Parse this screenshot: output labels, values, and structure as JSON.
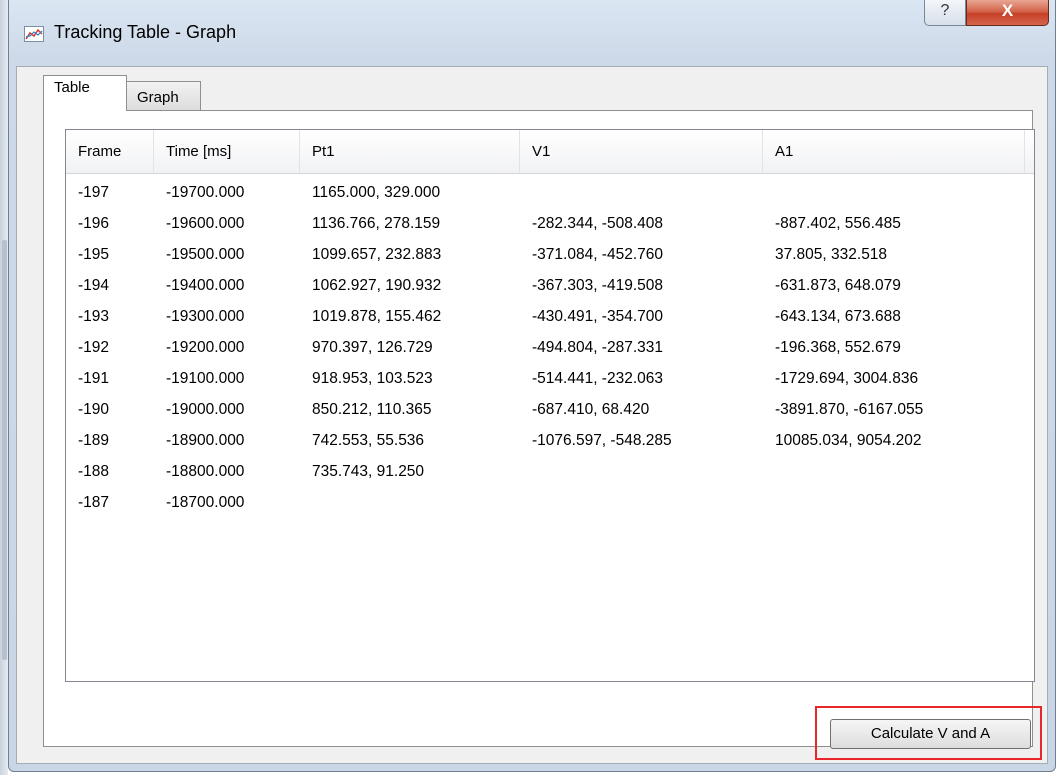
{
  "window": {
    "title": "Tracking Table - Graph",
    "help_glyph": "?",
    "close_glyph": "X"
  },
  "tabs": [
    {
      "label": "Table",
      "active": true
    },
    {
      "label": "Graph",
      "active": false
    }
  ],
  "table": {
    "columns": [
      "Frame",
      "Time [ms]",
      "Pt1",
      "V1",
      "A1"
    ],
    "rows": [
      [
        "-197",
        "-19700.000",
        "1165.000, 329.000",
        "",
        ""
      ],
      [
        "-196",
        "-19600.000",
        "1136.766, 278.159",
        "-282.344, -508.408",
        "-887.402, 556.485"
      ],
      [
        "-195",
        "-19500.000",
        "1099.657, 232.883",
        "-371.084, -452.760",
        "37.805, 332.518"
      ],
      [
        "-194",
        "-19400.000",
        "1062.927, 190.932",
        "-367.303, -419.508",
        "-631.873, 648.079"
      ],
      [
        "-193",
        "-19300.000",
        "1019.878, 155.462",
        "-430.491, -354.700",
        "-643.134, 673.688"
      ],
      [
        "-192",
        "-19200.000",
        "970.397, 126.729",
        "-494.804, -287.331",
        "-196.368, 552.679"
      ],
      [
        "-191",
        "-19100.000",
        "918.953, 103.523",
        "-514.441, -232.063",
        "-1729.694, 3004.836"
      ],
      [
        "-190",
        "-19000.000",
        "850.212, 110.365",
        "-687.410, 68.420",
        "-3891.870, -6167.055"
      ],
      [
        "-189",
        "-18900.000",
        "742.553, 55.536",
        "-1076.597, -548.285",
        "10085.034, 9054.202"
      ],
      [
        "-188",
        "-18800.000",
        "735.743, 91.250",
        "",
        ""
      ],
      [
        "-187",
        "-18700.000",
        "",
        "",
        ""
      ]
    ]
  },
  "buttons": {
    "calculate_label": "Calculate V and A"
  },
  "icons": {
    "title": "chart-line-icon"
  },
  "colors": {
    "highlight_border": "#e8262c",
    "close_button": "#c7412a"
  }
}
